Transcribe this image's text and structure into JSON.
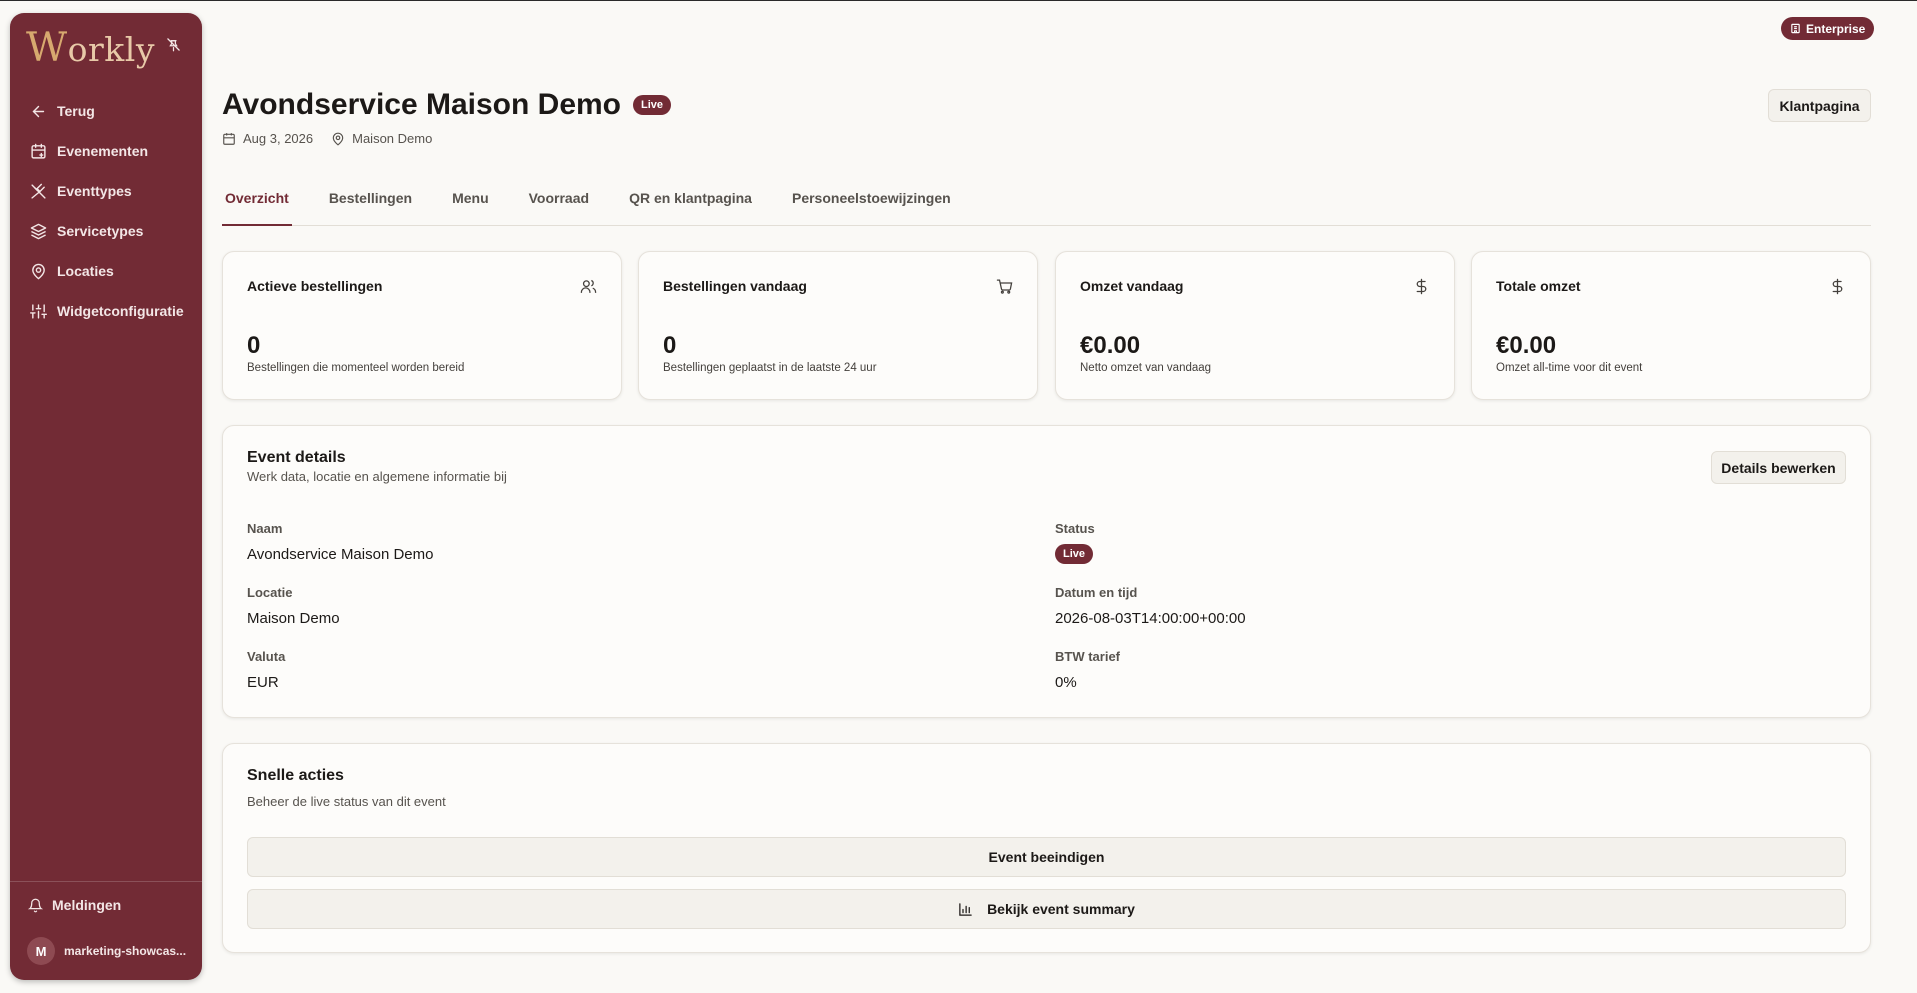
{
  "sidebar": {
    "logo_initial": "W",
    "logo_rest": "orkly",
    "nav": [
      {
        "label": "Terug",
        "icon": "arrow-left-icon"
      },
      {
        "label": "Evenementen",
        "icon": "calendar-plus-icon"
      },
      {
        "label": "Eventtypes",
        "icon": "utensils-crossed-icon"
      },
      {
        "label": "Servicetypes",
        "icon": "layers-icon"
      },
      {
        "label": "Locaties",
        "icon": "map-pin-icon"
      },
      {
        "label": "Widgetconfiguratie",
        "icon": "sliders-icon"
      }
    ],
    "notifications_label": "Meldingen",
    "user": {
      "initial": "M",
      "name": "marketing-showcas..."
    }
  },
  "header": {
    "plan_badge": "Enterprise",
    "title": "Avondservice Maison Demo",
    "status_badge": "Live",
    "date": "Aug 3, 2026",
    "location": "Maison Demo",
    "customer_page_button": "Klantpagina"
  },
  "tabs": [
    {
      "label": "Overzicht",
      "active": true
    },
    {
      "label": "Bestellingen",
      "active": false
    },
    {
      "label": "Menu",
      "active": false
    },
    {
      "label": "Voorraad",
      "active": false
    },
    {
      "label": "QR en klantpagina",
      "active": false
    },
    {
      "label": "Personeelstoewijzingen",
      "active": false
    }
  ],
  "stats": [
    {
      "title": "Actieve bestellingen",
      "value": "0",
      "description": "Bestellingen die momenteel worden bereid",
      "icon": "users-icon"
    },
    {
      "title": "Bestellingen vandaag",
      "value": "0",
      "description": "Bestellingen geplaatst in de laatste 24 uur",
      "icon": "cart-icon"
    },
    {
      "title": "Omzet vandaag",
      "value": "€0.00",
      "description": "Netto omzet van vandaag",
      "icon": "dollar-icon"
    },
    {
      "title": "Totale omzet",
      "value": "€0.00",
      "description": "Omzet all-time voor dit event",
      "icon": "dollar-icon"
    }
  ],
  "event_details": {
    "title": "Event details",
    "subtitle": "Werk data, locatie en algemene informatie bij",
    "edit_button": "Details bewerken",
    "fields": {
      "name_label": "Naam",
      "name_value": "Avondservice Maison Demo",
      "status_label": "Status",
      "status_value": "Live",
      "location_label": "Locatie",
      "location_value": "Maison Demo",
      "datetime_label": "Datum en tijd",
      "datetime_value": "2026-08-03T14:00:00+00:00",
      "currency_label": "Valuta",
      "currency_value": "EUR",
      "vat_label": "BTW tarief",
      "vat_value": "0%"
    }
  },
  "quick_actions": {
    "title": "Snelle acties",
    "subtitle": "Beheer de live status van dit event",
    "end_button": "Event beeindigen",
    "summary_button": "Bekijk event summary"
  },
  "colors": {
    "brand": "#722b35",
    "background": "#faf9f6",
    "logo": "#d7a96f"
  }
}
